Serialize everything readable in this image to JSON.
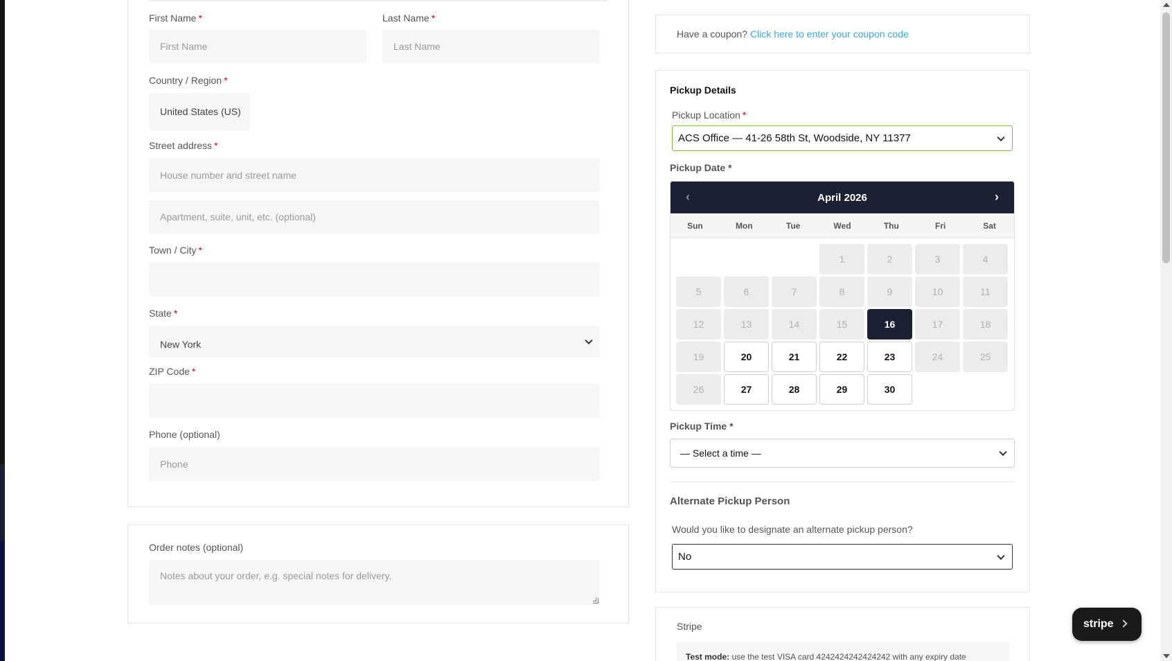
{
  "billing": {
    "first_name_label": "First Name",
    "first_name_placeholder": "First Name",
    "last_name_label": "Last Name",
    "last_name_placeholder": "Last Name",
    "country_label": "Country / Region",
    "country_value": "United States (US)",
    "street_label": "Street address",
    "street_placeholder": "House number and street name",
    "street2_placeholder": "Apartment, suite, unit, etc. (optional)",
    "city_label": "Town / City",
    "state_label": "State",
    "state_value": "New York",
    "zip_label": "ZIP Code",
    "phone_label": "Phone (optional)",
    "phone_placeholder": "Phone",
    "required_mark": "*"
  },
  "notes": {
    "label": "Order notes (optional)",
    "placeholder": "Notes about your order, e.g. special notes for delivery."
  },
  "coupon": {
    "text": "Have a coupon?",
    "link": "Click here to enter your coupon code"
  },
  "pickup": {
    "title": "Pickup Details",
    "location_label": "Pickup Location",
    "location_value": "ACS Office — 41-26 58th St, Woodside, NY 11377",
    "date_label": "Pickup Date *",
    "calendar": {
      "month": "April 2026",
      "prev": "‹",
      "next": "›",
      "weekdays": [
        "Sun",
        "Mon",
        "Tue",
        "Wed",
        "Thu",
        "Fri",
        "Sat"
      ],
      "days": [
        {
          "d": "",
          "s": "empty"
        },
        {
          "d": "",
          "s": "empty"
        },
        {
          "d": "",
          "s": "empty"
        },
        {
          "d": "1",
          "s": "disabled"
        },
        {
          "d": "2",
          "s": "disabled"
        },
        {
          "d": "3",
          "s": "disabled"
        },
        {
          "d": "4",
          "s": "disabled"
        },
        {
          "d": "5",
          "s": "disabled"
        },
        {
          "d": "6",
          "s": "disabled"
        },
        {
          "d": "7",
          "s": "disabled"
        },
        {
          "d": "8",
          "s": "disabled"
        },
        {
          "d": "9",
          "s": "disabled"
        },
        {
          "d": "10",
          "s": "disabled"
        },
        {
          "d": "11",
          "s": "disabled"
        },
        {
          "d": "12",
          "s": "disabled"
        },
        {
          "d": "13",
          "s": "disabled"
        },
        {
          "d": "14",
          "s": "disabled"
        },
        {
          "d": "15",
          "s": "disabled"
        },
        {
          "d": "16",
          "s": "selected"
        },
        {
          "d": "17",
          "s": "disabled"
        },
        {
          "d": "18",
          "s": "disabled"
        },
        {
          "d": "19",
          "s": "disabled"
        },
        {
          "d": "20",
          "s": "avail"
        },
        {
          "d": "21",
          "s": "avail"
        },
        {
          "d": "22",
          "s": "avail"
        },
        {
          "d": "23",
          "s": "avail"
        },
        {
          "d": "24",
          "s": "disabled"
        },
        {
          "d": "25",
          "s": "disabled"
        },
        {
          "d": "26",
          "s": "disabled"
        },
        {
          "d": "27",
          "s": "avail"
        },
        {
          "d": "28",
          "s": "avail"
        },
        {
          "d": "29",
          "s": "avail"
        },
        {
          "d": "30",
          "s": "avail"
        }
      ]
    },
    "time_label": "Pickup Time *",
    "time_value": "— Select a time —",
    "alt_title": "Alternate Pickup Person",
    "alt_question": "Would you like to designate an alternate pickup person?",
    "alt_value": "No"
  },
  "payment": {
    "title": "Stripe",
    "test_bold": "Test mode:",
    "test_text": " use the test VISA card 4242424242424242 with any expiry date"
  },
  "stripe_badge": {
    "label": "stripe"
  },
  "colors": {
    "accent_dark": "#1c2033",
    "link": "#3aa8d8",
    "required": "#d0021b",
    "valid_border": "#7ac143"
  }
}
